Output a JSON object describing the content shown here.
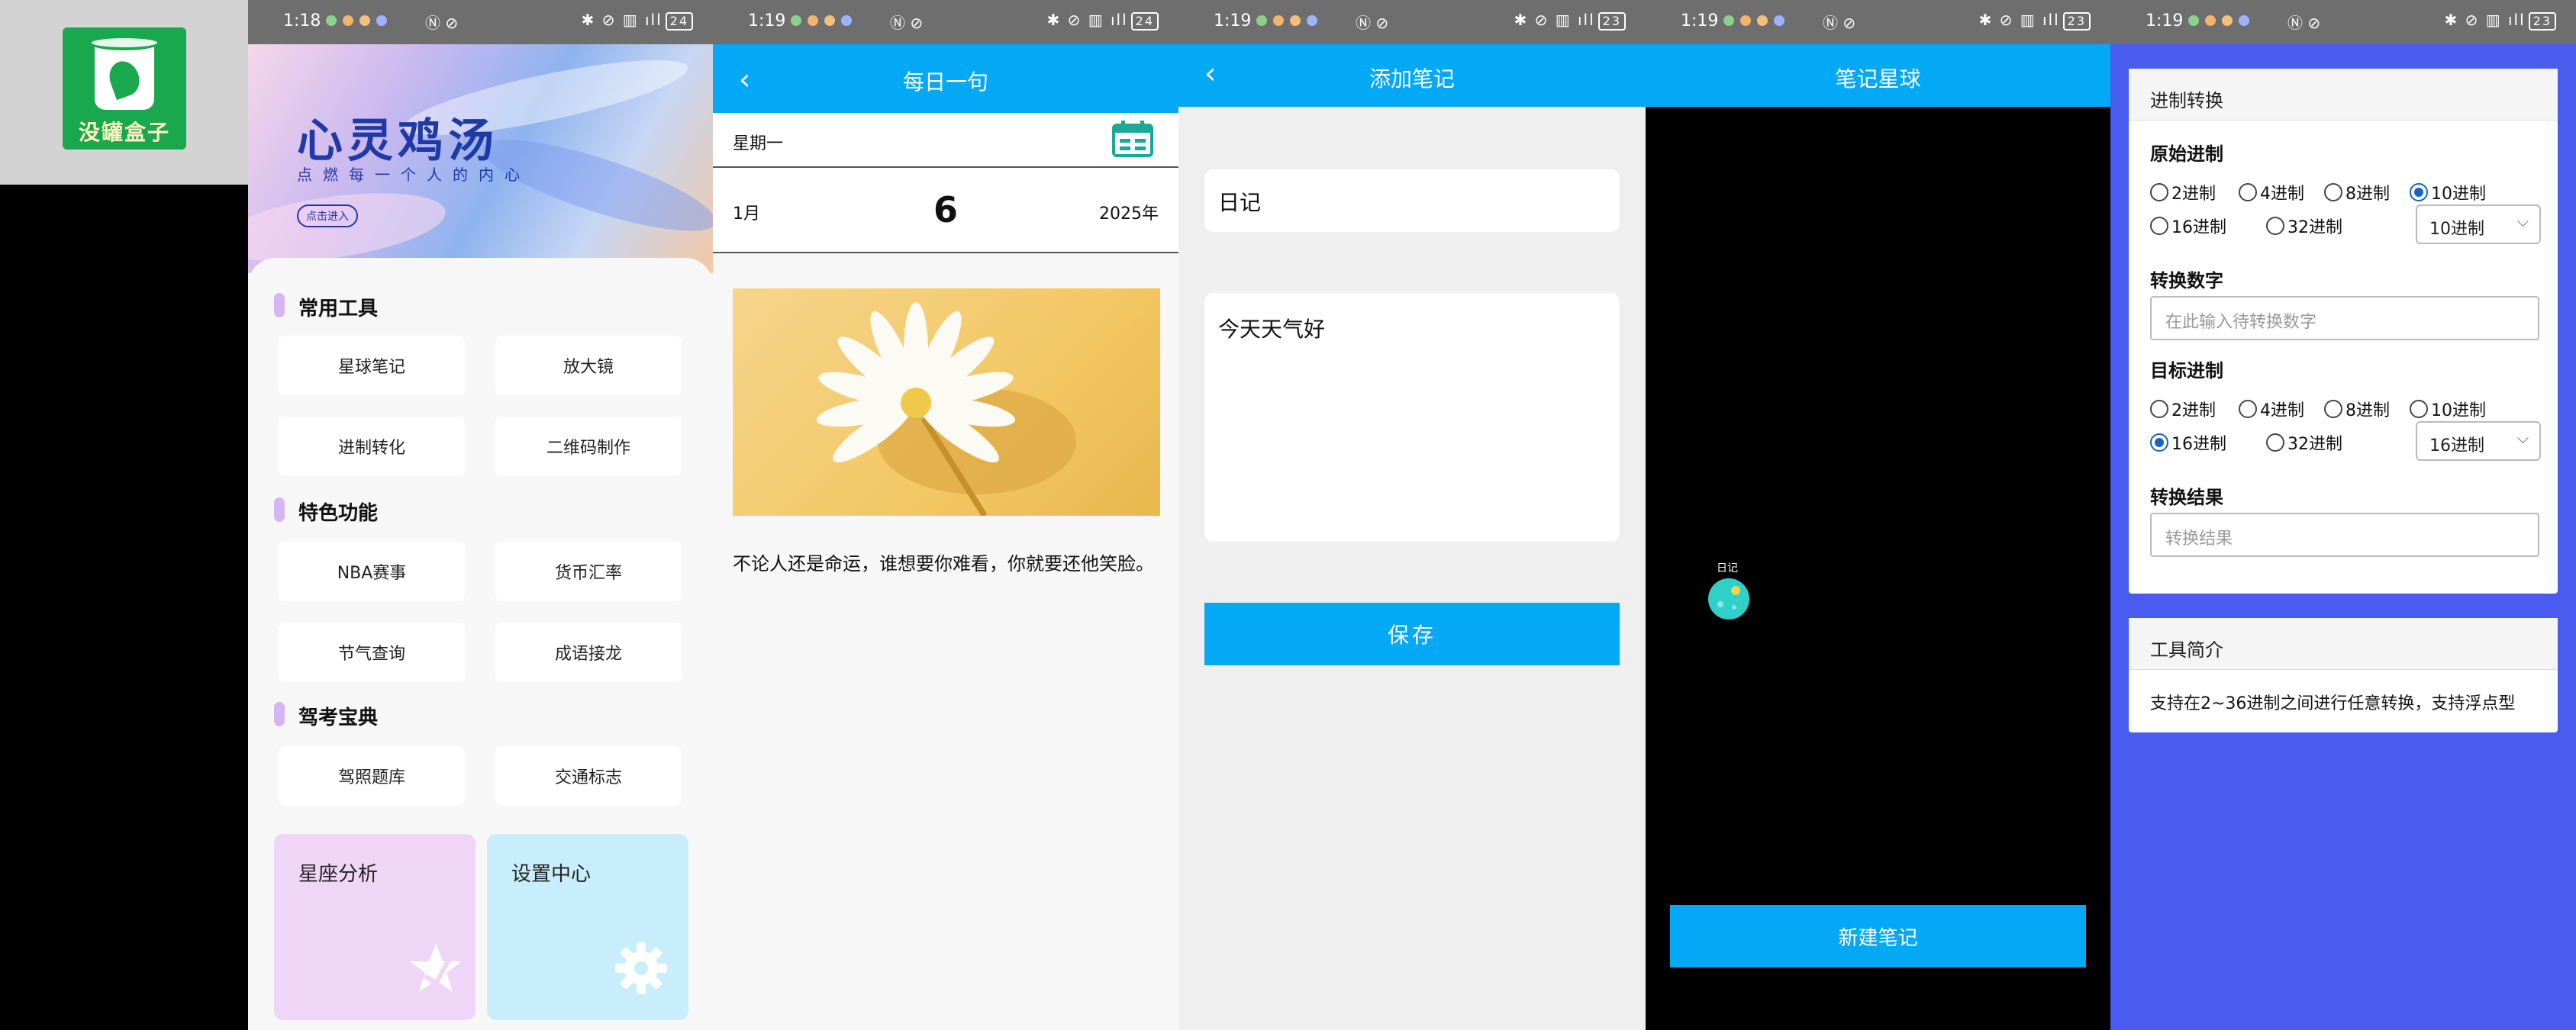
{
  "logo": {
    "text": "没罐盒子"
  },
  "status": {
    "p1_time": "1:18",
    "p2_time": "1:19",
    "p3_time": "1:19",
    "p4_time": "1:19",
    "p5_time": "1:19",
    "p1_batt": "24",
    "p2_batt": "24",
    "p3_batt": "23",
    "p4_batt": "23",
    "p5_batt": "23"
  },
  "home": {
    "banner_title": "心灵鸡汤",
    "banner_subtitle": "点燃每一个人的内心",
    "banner_button": "点击进入",
    "sections": [
      {
        "title": "常用工具",
        "items": [
          "星球笔记",
          "放大镜",
          "进制转化",
          "二维码制作"
        ]
      },
      {
        "title": "特色功能",
        "items": [
          "NBA赛事",
          "货币汇率",
          "节气查询",
          "成语接龙"
        ]
      },
      {
        "title": "驾考宝典",
        "items": [
          "驾照题库",
          "交通标志"
        ]
      }
    ],
    "card_zodiac": "星座分析",
    "card_settings": "设置中心"
  },
  "daily": {
    "title": "每日一句",
    "weekday": "星期一",
    "month": "1月",
    "day": "6",
    "year": "2025年",
    "quote": "不论人还是命运，谁想要你难看，你就要还他笑脸。"
  },
  "addnote": {
    "title": "添加笔记",
    "title_value": "日记",
    "content_value": "今天天气好",
    "save_label": "保存"
  },
  "planet": {
    "title": "笔记星球",
    "planet_label": "日记",
    "new_label": "新建笔记"
  },
  "radix": {
    "panel_title": "进制转换",
    "source_label": "原始进制",
    "source_options": [
      "2进制",
      "4进制",
      "8进制",
      "10进制",
      "16进制",
      "32进制"
    ],
    "source_selected": "10进制",
    "number_label": "转换数字",
    "number_placeholder": "在此输入待转换数字",
    "target_label": "目标进制",
    "target_options": [
      "2进制",
      "4进制",
      "8进制",
      "10进制",
      "16进制",
      "32进制"
    ],
    "target_selected": "16进制",
    "result_label": "转换结果",
    "result_placeholder": "转换结果",
    "intro_title": "工具简介",
    "intro_text": "支持在2~36进制之间进行任意转换，支持浮点型"
  },
  "colors": {
    "accent": "#03a9f4",
    "radix_bg": "#4a5cf0",
    "section_bar": "#d6b6f2"
  }
}
